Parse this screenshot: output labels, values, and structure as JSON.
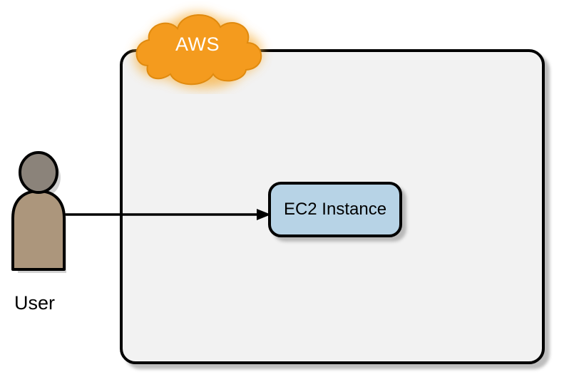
{
  "diagram": {
    "cloud_label": "AWS",
    "user_label": "User",
    "instance_label": "EC2 Instance",
    "colors": {
      "cloud_fill": "#f5a623",
      "cloud_stroke": "#df8c0a",
      "container_fill": "#f2f2f2",
      "instance_fill": "#b7d3e6",
      "user_body": "#ac967c",
      "user_head": "#8a8279"
    }
  }
}
